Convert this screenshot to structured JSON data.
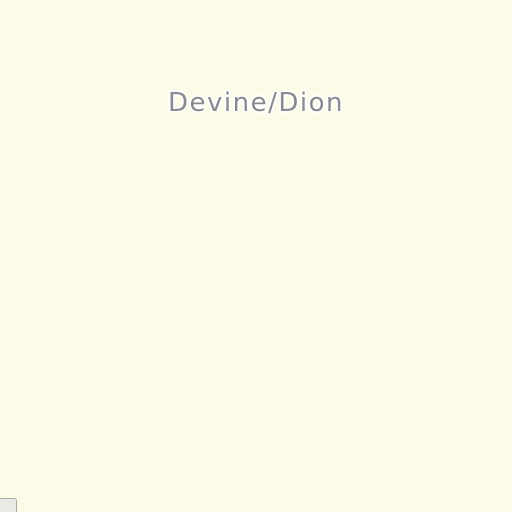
{
  "map": {
    "background_color": "#fcfbe8",
    "label_color": "#8a8a8e",
    "place_label": "Devine/Dion"
  }
}
